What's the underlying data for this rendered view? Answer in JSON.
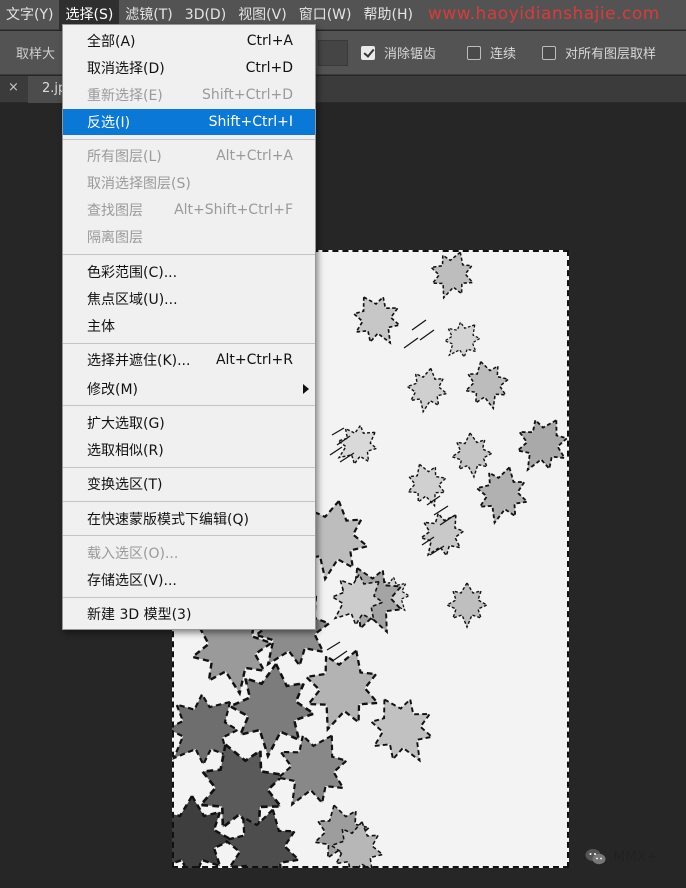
{
  "menubar": {
    "items": [
      {
        "label": "文字(Y)",
        "active": false
      },
      {
        "label": "选择(S)",
        "active": true
      },
      {
        "label": "滤镜(T)",
        "active": false
      },
      {
        "label": "3D(D)",
        "active": false
      },
      {
        "label": "视图(V)",
        "active": false
      },
      {
        "label": "窗口(W)",
        "active": false
      },
      {
        "label": "帮助(H)",
        "active": false
      }
    ],
    "watermark": "www.haoyidianshajie.com"
  },
  "options_bar": {
    "sample_label": "取样大",
    "anti_alias": {
      "label": "消除锯齿",
      "checked": true
    },
    "contiguous": {
      "label": "连续",
      "checked": false
    },
    "all_layers": {
      "label": "对所有图层取样",
      "checked": false
    }
  },
  "tabs": {
    "close_glyph": "×",
    "active_tab": "2.jp"
  },
  "select_menu": {
    "items": [
      {
        "label": "全部(A)",
        "shortcut": "Ctrl+A",
        "disabled": false
      },
      {
        "label": "取消选择(D)",
        "shortcut": "Ctrl+D",
        "disabled": false
      },
      {
        "label": "重新选择(E)",
        "shortcut": "Shift+Ctrl+D",
        "disabled": true
      },
      {
        "label": "反选(I)",
        "shortcut": "Shift+Ctrl+I",
        "disabled": false,
        "highlight": true
      },
      {
        "label": "所有图层(L)",
        "shortcut": "Alt+Ctrl+A",
        "disabled": true
      },
      {
        "label": "取消选择图层(S)",
        "shortcut": "",
        "disabled": true
      },
      {
        "label": "查找图层",
        "shortcut": "Alt+Shift+Ctrl+F",
        "disabled": true
      },
      {
        "label": "隔离图层",
        "shortcut": "",
        "disabled": true
      },
      {
        "label": "色彩范围(C)...",
        "shortcut": "",
        "disabled": false
      },
      {
        "label": "焦点区域(U)...",
        "shortcut": "",
        "disabled": false
      },
      {
        "label": "主体",
        "shortcut": "",
        "disabled": false
      },
      {
        "label": "选择并遮住(K)...",
        "shortcut": "Alt+Ctrl+R",
        "disabled": false
      },
      {
        "label": "修改(M)",
        "shortcut": "",
        "disabled": false,
        "submenu": true
      },
      {
        "label": "扩大选取(G)",
        "shortcut": "",
        "disabled": false
      },
      {
        "label": "选取相似(R)",
        "shortcut": "",
        "disabled": false
      },
      {
        "label": "变换选区(T)",
        "shortcut": "",
        "disabled": false
      },
      {
        "label": "在快速蒙版模式下编辑(Q)",
        "shortcut": "",
        "disabled": false
      },
      {
        "label": "载入选区(O)...",
        "shortcut": "",
        "disabled": true
      },
      {
        "label": "存储选区(V)...",
        "shortcut": "",
        "disabled": false
      },
      {
        "label": "新建 3D 模型(3)",
        "shortcut": "",
        "disabled": false
      }
    ]
  },
  "footer": {
    "brand": "MMX+"
  },
  "colors": {
    "highlight": "#0a78d7",
    "menubar": "#535353",
    "workspace": "#262626"
  }
}
